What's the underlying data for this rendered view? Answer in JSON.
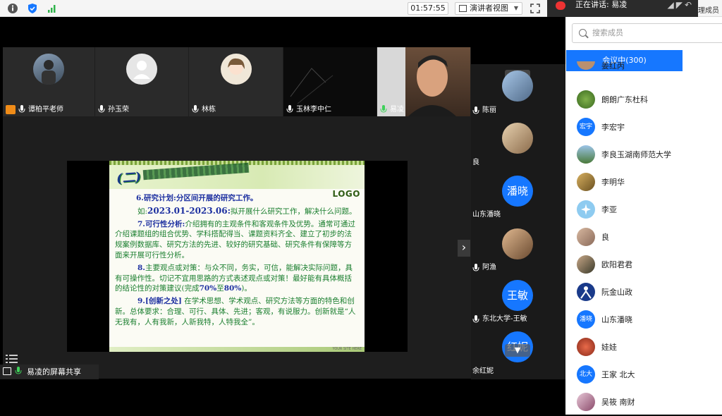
{
  "topbar": {
    "timer": "01:57:55",
    "presenter_view_label": "演讲者视图",
    "speaking_label": "正在讲话: 易凌",
    "manage_members_label": "理成员"
  },
  "video_tiles": [
    {
      "name": "谭柏平老师"
    },
    {
      "name": "孙玉荣"
    },
    {
      "name": "林栋"
    },
    {
      "name": "玉林李中仁"
    },
    {
      "name": "易凌"
    }
  ],
  "side_videos": [
    {
      "name": "陈丽"
    },
    {
      "name": "良"
    },
    {
      "avatar_text": "潘晓",
      "name": "山东潘晓"
    },
    {
      "name": "阿渔"
    },
    {
      "avatar_text": "王敏",
      "name": "东北大学-王敏"
    },
    {
      "avatar_text": "红妮",
      "name": "余红妮"
    }
  ],
  "slide": {
    "title": "(二)",
    "logo": "LOGO",
    "item6_head": "6.研究计划:",
    "item6_text": "分区间开展的研究工作。",
    "item6b_pre": "如:",
    "item6b_range": "2023.01-2023.06:",
    "item6b_text": "拟开展什么研究工作，解决什么问题。",
    "item7_head": "7.可行性分析:",
    "item7_text": "介绍拥有的主观条件和客观条件及优势。通常可通过介绍课题组的组合优势、学科搭配得当、课题资料齐全、建立了初步的法规案例数据库、研究方法的先进、较好的研究基础、研究条件有保障等方面来开展可行性分析。",
    "item8_head": "8.",
    "item8_text": "主要观点或对策：与众不同，务实，可信，能解决实际问题，具有可操作性。切记不宜用思路的方式表述观点或对策！最好能有具体概括的结论性的对策建议(完成",
    "item8_p1": "70%",
    "item8_mid": "至",
    "item8_p2": "80%",
    "item8_end": ")。",
    "item9_head": "9.[创新之处]",
    "item9_text": " 在学术思想、学术观点、研究方法等方面的特色和创新。总体要求：合理、可行、具体、先进；客观，有说服力。创新就是“人无我有，人有我新，人新我特，人特我全”。",
    "footer": "YOUR SITE HERE"
  },
  "share_label": "易凌的屏幕共享",
  "panel": {
    "search_placeholder": "搜索成员",
    "tab_in_meeting": "会议中(300)",
    "members": [
      {
        "name": "姜红丙"
      },
      {
        "name": "朗朗广东杜科"
      },
      {
        "avatar_text": "宏宇",
        "name": "李宏宇"
      },
      {
        "name": "李良玉湖南师范大学"
      },
      {
        "name": "李明华"
      },
      {
        "name": "李亚"
      },
      {
        "name": "良"
      },
      {
        "name": "欧阳君君"
      },
      {
        "name": "阮金山政"
      },
      {
        "avatar_text": "潘晓",
        "name": "山东潘晓"
      },
      {
        "name": "娃娃"
      },
      {
        "avatar_text": "北大",
        "name": "王家 北大"
      },
      {
        "name": "吴筱 南财"
      }
    ]
  }
}
